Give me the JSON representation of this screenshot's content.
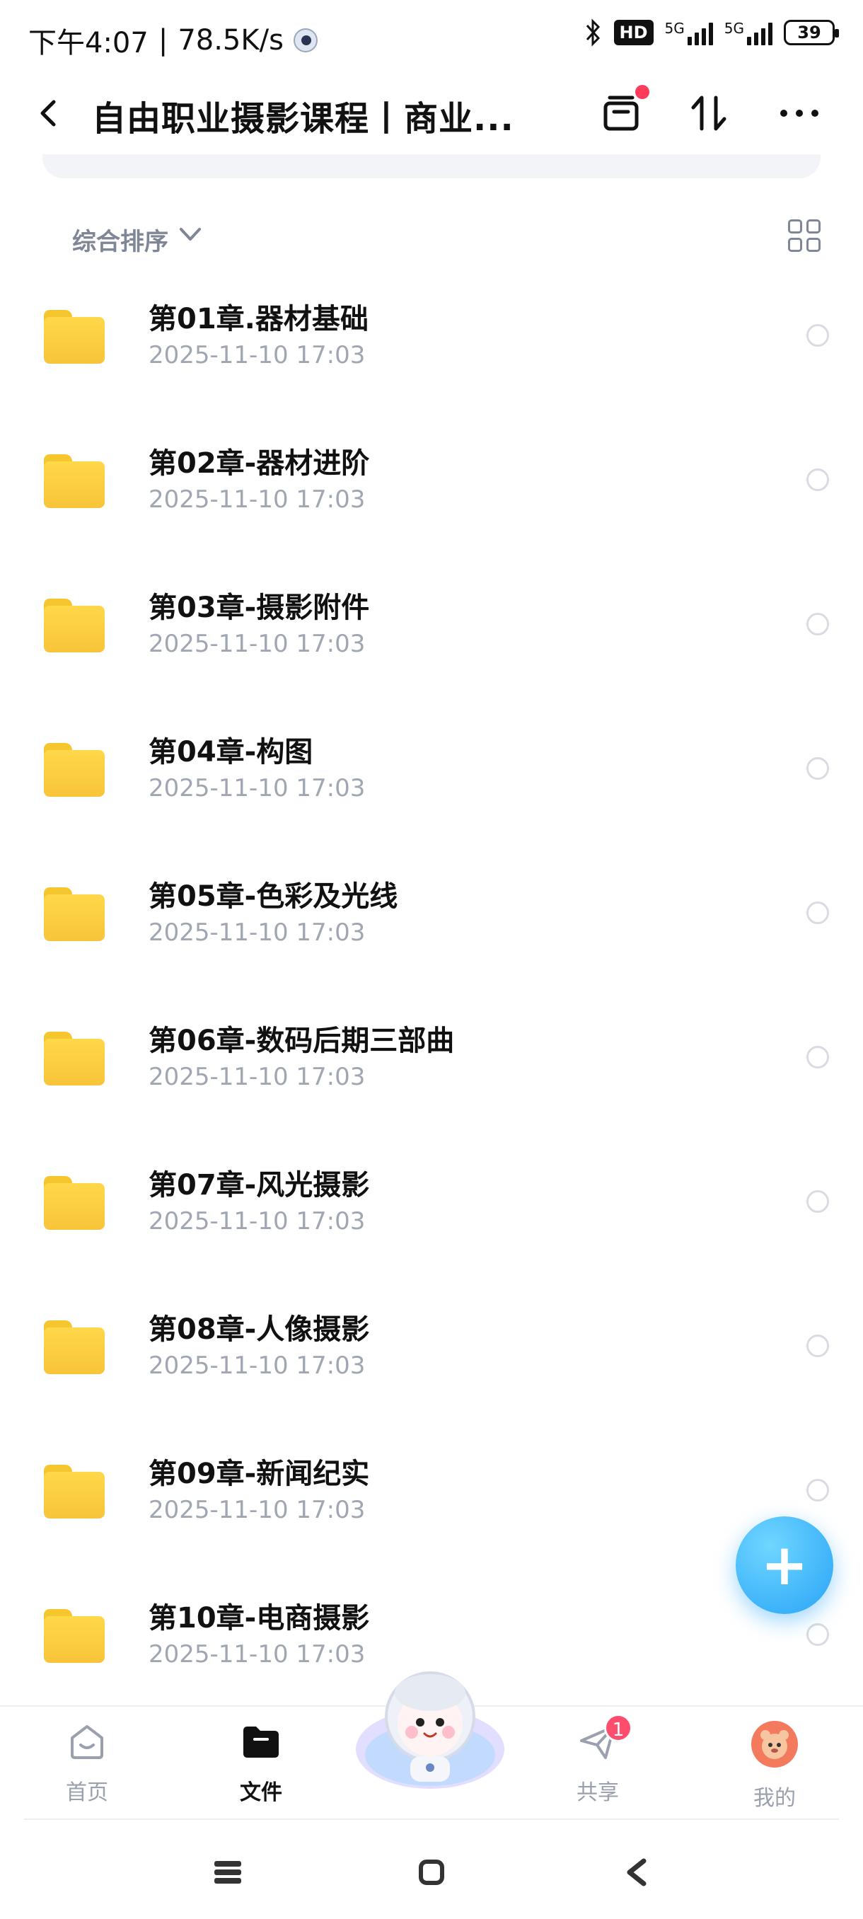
{
  "status_bar": {
    "time": "下午4:07",
    "net_speed": "78.5K/s",
    "hd_label": "HD",
    "network_1": "5G",
    "network_2": "5G",
    "battery": "39"
  },
  "header": {
    "title": "自由职业摄影课程丨商业...",
    "back_icon": "chevron-left-icon",
    "icons": [
      "inbox-icon",
      "sort-arrows-icon",
      "more-icon"
    ]
  },
  "sort": {
    "label": "综合排序",
    "view_icon": "grid-view-icon"
  },
  "files": [
    {
      "name": "第01章.器材基础",
      "date": "2025-11-10  17:03"
    },
    {
      "name": "第02章-器材进阶",
      "date": "2025-11-10  17:03"
    },
    {
      "name": "第03章-摄影附件",
      "date": "2025-11-10  17:03"
    },
    {
      "name": "第04章-构图",
      "date": "2025-11-10  17:03"
    },
    {
      "name": "第05章-色彩及光线",
      "date": "2025-11-10  17:03"
    },
    {
      "name": "第06章-数码后期三部曲",
      "date": "2025-11-10  17:03"
    },
    {
      "name": "第07章-风光摄影",
      "date": "2025-11-10  17:03"
    },
    {
      "name": "第08章-人像摄影",
      "date": "2025-11-10  17:03"
    },
    {
      "name": "第09章-新闻纪实",
      "date": "2025-11-10  17:03"
    },
    {
      "name": "第10章-电商摄影",
      "date": "2025-11-10  17:03"
    }
  ],
  "fab": {
    "icon": "plus-icon"
  },
  "bottom_nav": {
    "home": "首页",
    "files": "文件",
    "share": "共享",
    "share_badge": "1",
    "mine": "我的"
  },
  "colors": {
    "accent": "#29a4f7",
    "folder": "#f8c43a",
    "badge": "#ff4d6d",
    "muted": "#a0a6b2"
  }
}
